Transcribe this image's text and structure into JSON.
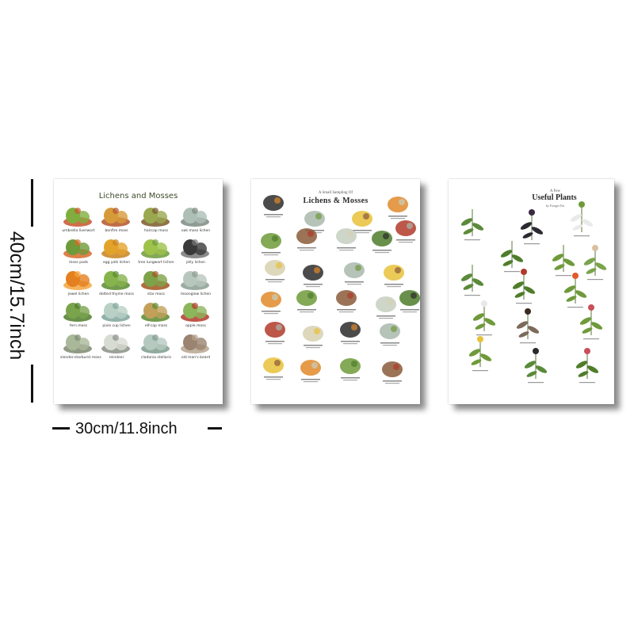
{
  "dimensions": {
    "height_label": "40cm/15.7inch",
    "width_label": "30cm/11.8inch"
  },
  "posters": [
    {
      "title": "Lichens and Mosses",
      "labels": [
        "umbrella liverwort",
        "bonfire moss",
        "haircap moss",
        "oak moss lichen",
        "moss pads",
        "egg yolk lichen",
        "tree lungwort lichen",
        "jelly lichen",
        "jewel lichen",
        "dotted thyme moss",
        "star moss",
        "moonglow lichen",
        "fern moss",
        "pixie cup lichen",
        "elf-cap moss",
        "apple moss",
        "slender-starburst moss",
        "reindeer",
        "cladonia stellaris",
        "old man's beard"
      ]
    },
    {
      "subtitle": "A Small Sampling Of",
      "title": "Lichens & Mosses"
    },
    {
      "subtitle": "A Few",
      "title": "Useful Plants",
      "author": "by Forager Pat"
    }
  ],
  "colors": {
    "moss_green": "#6f9a3a",
    "lichen_orange": "#e0892a",
    "lichen_grey": "#a9b8ad",
    "dark_lichen": "#2b2b2b",
    "berry_red": "#b03a2a"
  }
}
